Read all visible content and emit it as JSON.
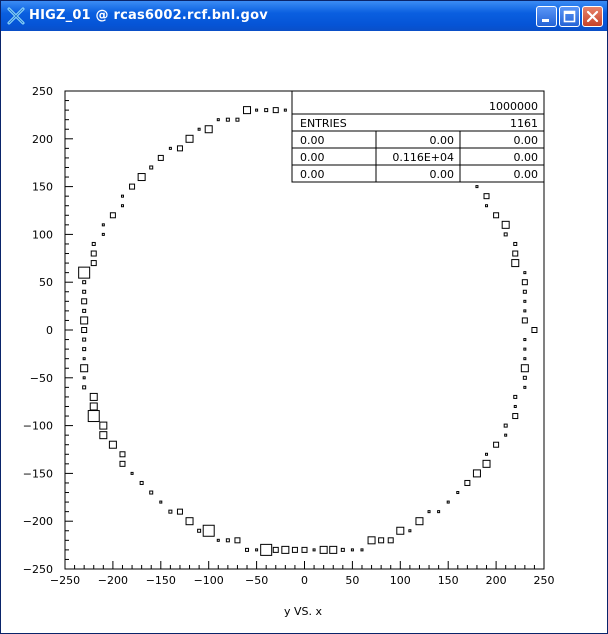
{
  "window": {
    "title": "HIGZ_01 @ rcas6002.rcf.bnl.gov",
    "icons": {
      "app": "x-icon",
      "minimize": "minimize-icon",
      "maximize": "maximize-icon",
      "close": "close-icon"
    }
  },
  "stats_box": {
    "rows": [
      [
        "",
        "",
        "1000000"
      ],
      [
        "ENTRIES",
        "",
        "1161"
      ],
      [
        "0.00",
        "0.00",
        "0.00"
      ],
      [
        "0.00",
        "0.116E+04",
        "0.00"
      ],
      [
        "0.00",
        "0.00",
        "0.00"
      ]
    ]
  },
  "chart_data": {
    "type": "scatter",
    "title": "",
    "xlabel": "y VS. x",
    "ylabel": "",
    "xlim": [
      -250,
      250
    ],
    "ylim": [
      -250,
      250
    ],
    "xticks": [
      -250,
      -200,
      -150,
      -100,
      -50,
      0,
      50,
      100,
      150,
      200,
      250
    ],
    "yticks": [
      -250,
      -200,
      -150,
      -100,
      -50,
      0,
      50,
      100,
      150,
      200,
      250
    ],
    "tick_labels_x": [
      "−250",
      "−200",
      "−150",
      "−100",
      "−50",
      "0",
      "50",
      "100",
      "150",
      "200",
      "250"
    ],
    "tick_labels_y": [
      "−250",
      "−200",
      "−150",
      "−100",
      "−50",
      "0",
      "50",
      "100",
      "150",
      "200",
      "250"
    ],
    "box_radius": 235,
    "box_angle_step_deg": 5,
    "box_count": 72,
    "grid": false,
    "legend": "none"
  }
}
